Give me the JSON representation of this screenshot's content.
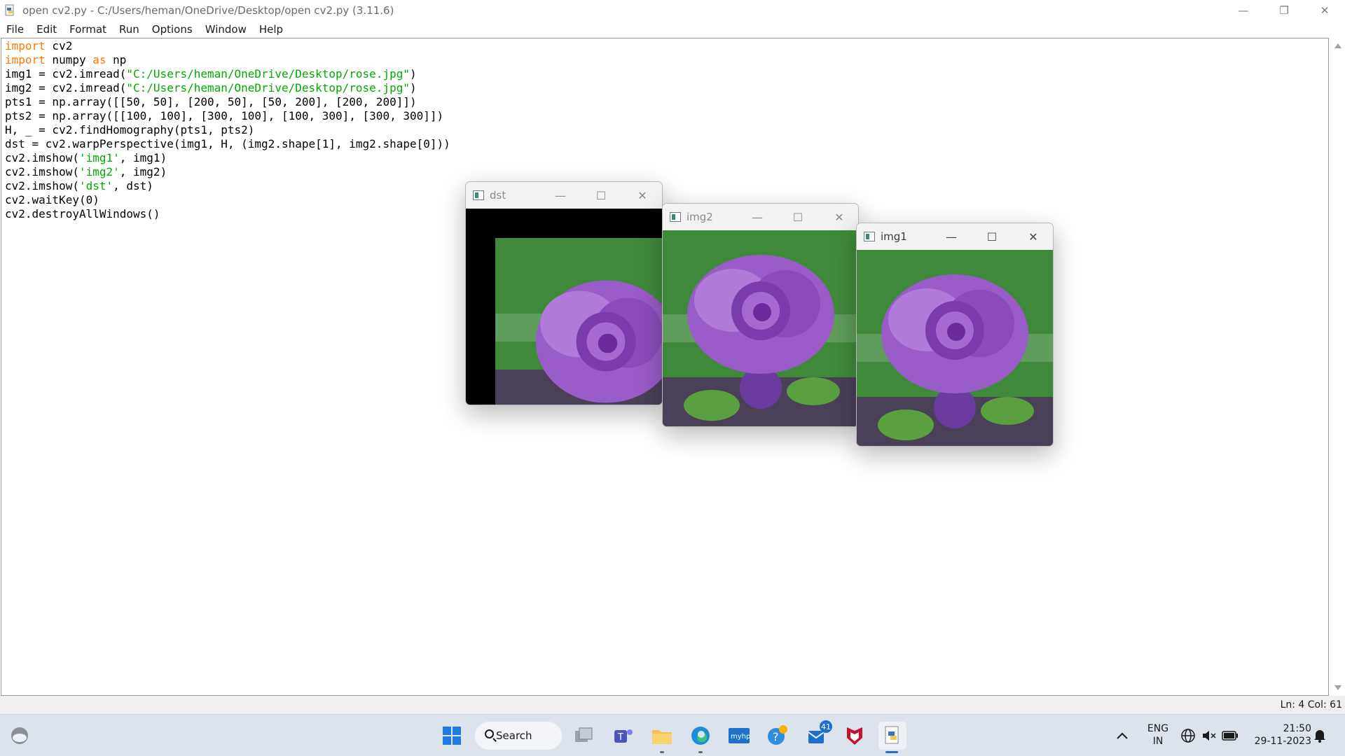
{
  "window": {
    "title": "open cv2.py - C:/Users/heman/OneDrive/Desktop/open cv2.py (3.11.6)",
    "controls": [
      "minimize-icon",
      "restore-icon",
      "close-icon"
    ]
  },
  "menu": [
    "File",
    "Edit",
    "Format",
    "Run",
    "Options",
    "Window",
    "Help"
  ],
  "code_lines": [
    [
      {
        "t": "import",
        "c": "kw"
      },
      {
        "t": " cv2",
        "c": ""
      }
    ],
    [
      {
        "t": "import",
        "c": "kw"
      },
      {
        "t": " numpy ",
        "c": ""
      },
      {
        "t": "as",
        "c": "kw"
      },
      {
        "t": " np",
        "c": ""
      }
    ],
    [
      {
        "t": "img1 = cv2.imread(",
        "c": ""
      },
      {
        "t": "\"C:/Users/heman/OneDrive/Desktop/rose.jpg\"",
        "c": "str"
      },
      {
        "t": ")",
        "c": ""
      }
    ],
    [
      {
        "t": "img2 = cv2.imread(",
        "c": ""
      },
      {
        "t": "\"C:/Users/heman/OneDrive/Desktop/rose.jpg\"",
        "c": "str"
      },
      {
        "t": ")",
        "c": ""
      }
    ],
    [
      {
        "t": "pts1 = np.array([[50, 50], [200, 50], [50, 200], [200, 200]])",
        "c": ""
      }
    ],
    [
      {
        "t": "pts2 = np.array([[100, 100], [300, 100], [100, 300], [300, 300]])",
        "c": ""
      }
    ],
    [
      {
        "t": "H, _ = cv2.findHomography(pts1, pts2)",
        "c": ""
      }
    ],
    [
      {
        "t": "dst = cv2.warpPerspective(img1, H, (img2.shape[1], img2.shape[0]))",
        "c": ""
      }
    ],
    [
      {
        "t": "cv2.imshow(",
        "c": ""
      },
      {
        "t": "'img1'",
        "c": "str"
      },
      {
        "t": ", img1)",
        "c": ""
      }
    ],
    [
      {
        "t": "cv2.imshow(",
        "c": ""
      },
      {
        "t": "'img2'",
        "c": "str"
      },
      {
        "t": ", img2)",
        "c": ""
      }
    ],
    [
      {
        "t": "cv2.imshow(",
        "c": ""
      },
      {
        "t": "'dst'",
        "c": "str"
      },
      {
        "t": ", dst)",
        "c": ""
      }
    ],
    [
      {
        "t": "cv2.waitKey(0)",
        "c": ""
      }
    ],
    [
      {
        "t": "cv2.destroyAllWindows()",
        "c": ""
      }
    ]
  ],
  "status": {
    "position": "Ln: 4   Col: 61"
  },
  "cv_windows": [
    {
      "name": "dst"
    },
    {
      "name": "img2"
    },
    {
      "name": "img1"
    }
  ],
  "taskbar": {
    "search_label": "Search",
    "mail_badge": "41",
    "tray_lang_1": "ENG",
    "tray_lang_2": "IN",
    "time": "21:50",
    "date": "29-11-2023"
  },
  "colors": {
    "keyword": "#ff7700",
    "string": "#00aa00",
    "rose": "#9a5cc8",
    "leaf": "#3f8a3a"
  }
}
